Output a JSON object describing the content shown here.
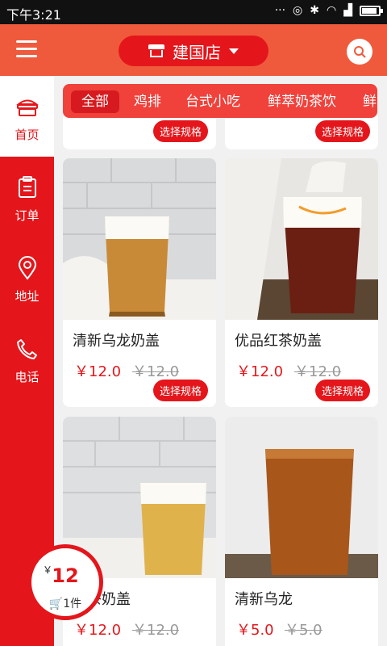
{
  "status_bar": {
    "time": "下午3:21"
  },
  "header": {
    "store_name": "建国店"
  },
  "sidebar": {
    "items": [
      {
        "label": "首页",
        "icon": "home-icon"
      },
      {
        "label": "订单",
        "icon": "clipboard-icon"
      },
      {
        "label": "地址",
        "icon": "location-pin-icon"
      },
      {
        "label": "电话",
        "icon": "phone-icon"
      }
    ]
  },
  "categories": [
    "全部",
    "鸡排",
    "台式小吃",
    "鲜萃奶茶饮",
    "鲜"
  ],
  "spec_button_label": "选择规格",
  "products": [
    {
      "name": "清新乌龙奶盖",
      "price": "￥12.0",
      "old_price": "￥12.0"
    },
    {
      "name": "优品红茶奶盖",
      "price": "￥12.0",
      "old_price": "￥12.0"
    },
    {
      "name": "花茶奶盖",
      "price": "￥12.0",
      "old_price": "￥12.0"
    },
    {
      "name": "清新乌龙",
      "price": "￥5.0",
      "old_price": "￥5.0"
    }
  ],
  "cart": {
    "currency": "￥",
    "total": "12",
    "count_label": "1件"
  },
  "colors": {
    "brand_red": "#e4161b",
    "header_orange": "#f05a3c"
  }
}
